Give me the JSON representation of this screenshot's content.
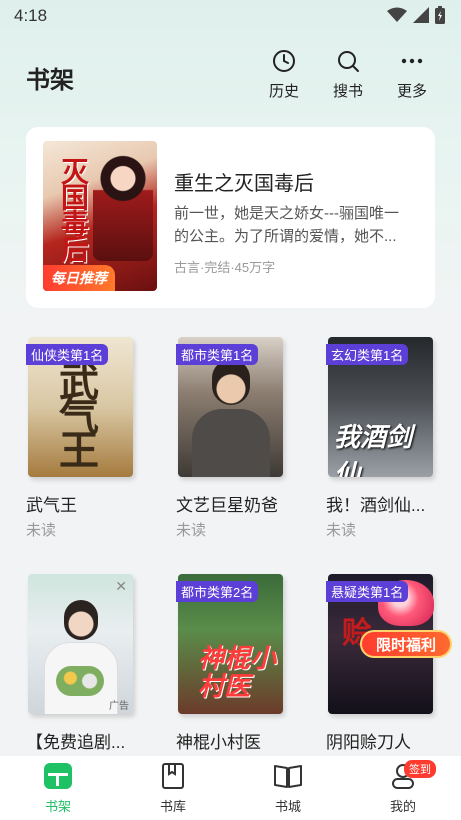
{
  "status_bar": {
    "time": "4:18"
  },
  "header": {
    "title": "书架",
    "actions": [
      {
        "label": "历史",
        "icon": "clock-icon"
      },
      {
        "label": "搜书",
        "icon": "search-icon"
      },
      {
        "label": "更多",
        "icon": "more-icon"
      }
    ]
  },
  "featured": {
    "title": "重生之灭国毒后",
    "description": "前一世，她是天之娇女---骊国唯一的公主。为了所谓的爱情，她不...",
    "meta": "古言·完结·45万字",
    "badge": "每日推荐",
    "cover_text": "灭国毒后"
  },
  "books": [
    {
      "name": "武气王",
      "status": "未读",
      "rank": "仙侠类第1名",
      "cover_text": "武气王"
    },
    {
      "name": "文艺巨星奶爸",
      "status": "未读",
      "rank": "都市类第1名",
      "cover_text": ""
    },
    {
      "name": "我！酒剑仙...",
      "status": "未读",
      "rank": "玄幻类第1名",
      "cover_text": "我酒剑仙"
    },
    {
      "name": "【免费追剧...",
      "status": "",
      "rank": "",
      "cover_text": "",
      "ad_label": "广告"
    },
    {
      "name": "神棍小村医",
      "status": "",
      "rank": "都市类第2名",
      "cover_text": "神棍小村医"
    },
    {
      "name": "阴阳赊刀人",
      "status": "",
      "rank": "悬疑类第1名",
      "cover_text": "赊"
    }
  ],
  "promo": {
    "label": "限时福利"
  },
  "tabbar": {
    "items": [
      {
        "label": "书架",
        "icon": "bookshelf-icon",
        "active": true
      },
      {
        "label": "书库",
        "icon": "library-icon",
        "active": false
      },
      {
        "label": "书城",
        "icon": "bookstore-icon",
        "active": false
      },
      {
        "label": "我的",
        "icon": "profile-icon",
        "active": false,
        "badge": "签到"
      }
    ]
  },
  "colors": {
    "accent": "#1ec164",
    "rank_badge": "#5b3fd6",
    "promo": "#ff3d2e"
  }
}
